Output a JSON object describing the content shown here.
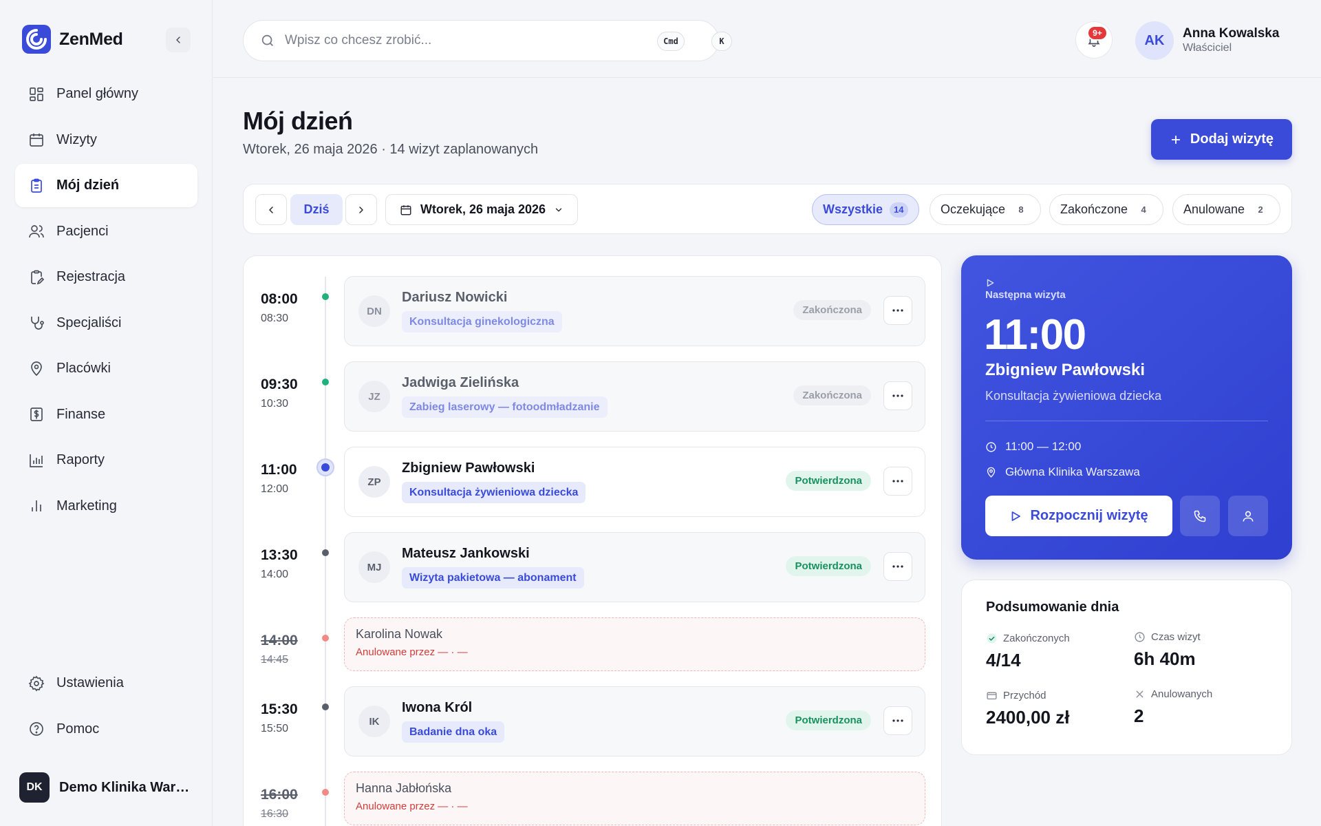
{
  "app": {
    "name": "ZenMed"
  },
  "sidebar": {
    "items": [
      {
        "label": "Panel główny",
        "icon": "dashboard-icon"
      },
      {
        "label": "Wizyty",
        "icon": "calendar-icon"
      },
      {
        "label": "Mój dzień",
        "icon": "clipboard-icon",
        "active": true
      },
      {
        "label": "Pacjenci",
        "icon": "users-icon"
      },
      {
        "label": "Rejestracja",
        "icon": "clipboard-edit-icon"
      },
      {
        "label": "Specjaliści",
        "icon": "stethoscope-icon"
      },
      {
        "label": "Placówki",
        "icon": "map-pin-icon"
      },
      {
        "label": "Finanse",
        "icon": "dollar-icon"
      },
      {
        "label": "Raporty",
        "icon": "bar-chart-icon"
      },
      {
        "label": "Marketing",
        "icon": "bar-chart-2-icon"
      }
    ],
    "bottom": [
      {
        "label": "Ustawienia",
        "icon": "gear-icon"
      },
      {
        "label": "Pomoc",
        "icon": "help-icon"
      }
    ],
    "org": {
      "initials": "DK",
      "name": "Demo Klinika Warszawa"
    }
  },
  "topbar": {
    "search_placeholder": "Wpisz co chcesz zrobić...",
    "shortcut_mod": "Cmd",
    "shortcut_key": "K",
    "notifications": "9+",
    "user": {
      "initials": "AK",
      "name": "Anna Kowalska",
      "role": "Właściciel"
    }
  },
  "header": {
    "title": "Mój dzień",
    "subtitle": "Wtorek, 26 maja 2026 · 14 wizyt zaplanowanych",
    "add_button": "Dodaj wizytę"
  },
  "filters": {
    "today": "Dziś",
    "date": "Wtorek, 26 maja 2026",
    "tabs": [
      {
        "label": "Wszystkie",
        "count": "14",
        "active": true
      },
      {
        "label": "Oczekujące",
        "count": "8"
      },
      {
        "label": "Zakończone",
        "count": "4"
      },
      {
        "label": "Anulowane",
        "count": "2"
      }
    ]
  },
  "schedule": [
    {
      "start": "08:00",
      "end": "08:30",
      "initials": "DN",
      "name": "Dariusz Nowicki",
      "service": "Konsultacja ginekologiczna",
      "status": "Zakończona",
      "state": "done"
    },
    {
      "start": "09:30",
      "end": "10:30",
      "initials": "JZ",
      "name": "Jadwiga Zielińska",
      "service": "Zabieg laserowy — fotoodmładzanie",
      "status": "Zakończona",
      "state": "done"
    },
    {
      "start": "11:00",
      "end": "12:00",
      "initials": "ZP",
      "name": "Zbigniew Pawłowski",
      "service": "Konsultacja żywieniowa dziecka",
      "status": "Potwierdzona",
      "state": "current"
    },
    {
      "start": "13:30",
      "end": "14:00",
      "initials": "MJ",
      "name": "Mateusz Jankowski",
      "service": "Wizyta pakietowa — abonament",
      "status": "Potwierdzona",
      "state": "upcoming"
    },
    {
      "start": "14:00",
      "end": "14:45",
      "name": "Karolina Nowak",
      "note": "Anulowane przez — · —",
      "state": "cancelled"
    },
    {
      "start": "15:30",
      "end": "15:50",
      "initials": "IK",
      "name": "Iwona Król",
      "service": "Badanie dna oka",
      "status": "Potwierdzona",
      "state": "upcoming"
    },
    {
      "start": "16:00",
      "end": "16:30",
      "name": "Hanna Jabłońska",
      "note": "Anulowane przez — · —",
      "state": "cancelled"
    }
  ],
  "next_visit": {
    "label": "Następna wizyta",
    "time": "11:00",
    "name": "Zbigniew Pawłowski",
    "service": "Konsultacja żywieniowa dziecka",
    "range": "11:00 — 12:00",
    "location": "Główna Klinika Warszawa",
    "start_button": "Rozpocznij wizytę"
  },
  "summary": {
    "title": "Podsumowanie dnia",
    "completed_label": "Zakończonych",
    "completed_value": "4/14",
    "duration_label": "Czas wizyt",
    "duration_value": "6h 40m",
    "revenue_label": "Przychód",
    "revenue_value": "2400,00 zł",
    "cancelled_label": "Anulowanych",
    "cancelled_value": "2"
  },
  "colors": {
    "accent": "#3a4bd9",
    "success": "#17915f",
    "danger": "#d23c3a"
  }
}
